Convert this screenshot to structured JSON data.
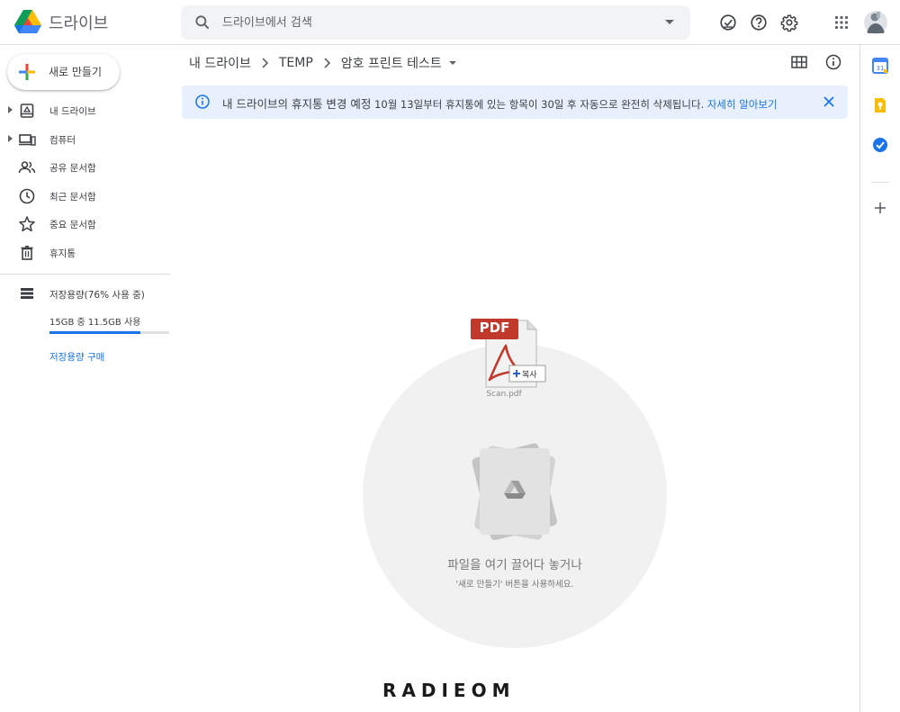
{
  "app": {
    "name": "드라이브"
  },
  "search": {
    "placeholder": "드라이브에서 검색"
  },
  "sidebar": {
    "new_label": "새로 만들기",
    "items": [
      {
        "label": "내 드라이브",
        "icon": "my-drive-icon",
        "expandable": true
      },
      {
        "label": "컴퓨터",
        "icon": "computers-icon",
        "expandable": true
      },
      {
        "label": "공유 문서함",
        "icon": "shared-icon",
        "expandable": false
      },
      {
        "label": "최근 문서함",
        "icon": "clock-icon",
        "expandable": false
      },
      {
        "label": "중요 문서함",
        "icon": "star-icon",
        "expandable": false
      },
      {
        "label": "휴지통",
        "icon": "trash-icon",
        "expandable": false
      }
    ],
    "storage": {
      "title": "저장용량(76% 사용 중)",
      "usage_text": "15GB 중 11.5GB 사용",
      "percent_used": 76,
      "buy_label": "저장용량 구매"
    }
  },
  "breadcrumb": {
    "root": "내 드라이브",
    "parent": "TEMP",
    "current": "암호 프린트 테스트"
  },
  "banner": {
    "title": "내 드라이브의 휴지통 변경 예정",
    "message": " 10월 13일부터 휴지통에 있는 항목이 30일 후 자동으로 완전히 삭제됩니다. ",
    "link": "자세히 알아보기"
  },
  "empty_state": {
    "title": "파일을 여기 끌어다 놓거나",
    "subtitle": "'새로 만들기' 버튼을 사용하세요."
  },
  "drag_file": {
    "name": "Scan.pdf",
    "badge": "PDF",
    "copy_label": "복사"
  },
  "watermark": "RADIEOM",
  "colors": {
    "accent": "#1a73e8",
    "banner_bg": "#e8f0fe",
    "pdf_red": "#c0392b"
  }
}
